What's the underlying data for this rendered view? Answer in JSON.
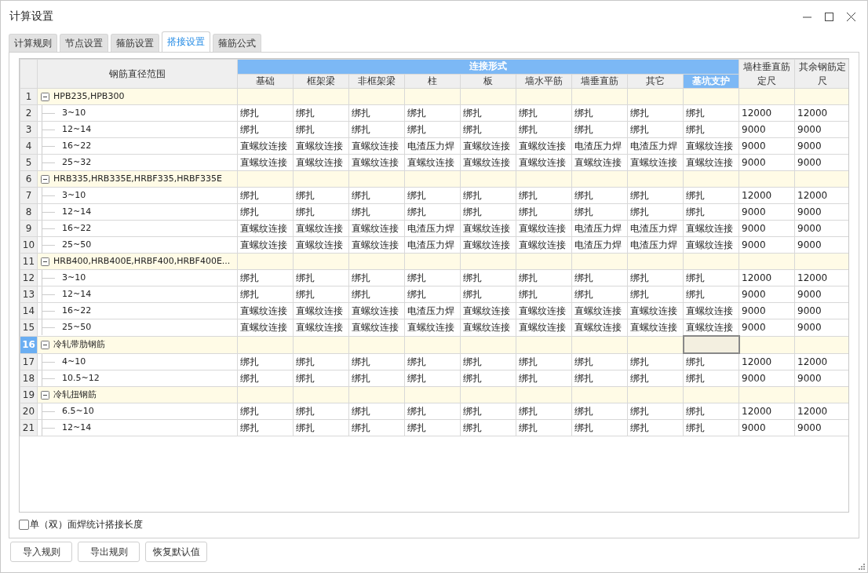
{
  "window": {
    "title": "计算设置"
  },
  "tabs": [
    {
      "label": "计算规则",
      "selected": false
    },
    {
      "label": "节点设置",
      "selected": false
    },
    {
      "label": "箍筋设置",
      "selected": false
    },
    {
      "label": "搭接设置",
      "selected": true
    },
    {
      "label": "箍筋公式",
      "selected": false
    }
  ],
  "table": {
    "name_header": "钢筋直径范围",
    "group_header": "连接形式",
    "columns": [
      {
        "label": "基础",
        "selected": false
      },
      {
        "label": "框架梁",
        "selected": false
      },
      {
        "label": "非框架梁",
        "selected": false
      },
      {
        "label": "柱",
        "selected": false
      },
      {
        "label": "板",
        "selected": false
      },
      {
        "label": "墙水平筋",
        "selected": false
      },
      {
        "label": "墙垂直筋",
        "selected": false
      },
      {
        "label": "其它",
        "selected": false
      },
      {
        "label": "基坑支护",
        "selected": true
      }
    ],
    "extra_columns": [
      "墙柱垂直筋定尺",
      "其余钢筋定尺"
    ],
    "rows": [
      {
        "number": "1",
        "selected": false,
        "kind": "group",
        "label": "HPB235,HPB300",
        "expanded": true
      },
      {
        "number": "2",
        "selected": false,
        "kind": "item",
        "label": "3~10",
        "cells": [
          "绑扎",
          "绑扎",
          "绑扎",
          "绑扎",
          "绑扎",
          "绑扎",
          "绑扎",
          "绑扎",
          "绑扎",
          "12000",
          "12000"
        ]
      },
      {
        "number": "3",
        "selected": false,
        "kind": "item",
        "label": "12~14",
        "cells": [
          "绑扎",
          "绑扎",
          "绑扎",
          "绑扎",
          "绑扎",
          "绑扎",
          "绑扎",
          "绑扎",
          "绑扎",
          "9000",
          "9000"
        ]
      },
      {
        "number": "4",
        "selected": false,
        "kind": "item",
        "label": "16~22",
        "cells": [
          "直螺纹连接",
          "直螺纹连接",
          "直螺纹连接",
          "电渣压力焊",
          "直螺纹连接",
          "直螺纹连接",
          "电渣压力焊",
          "电渣压力焊",
          "直螺纹连接",
          "9000",
          "9000"
        ]
      },
      {
        "number": "5",
        "selected": false,
        "kind": "item",
        "label": "25~32",
        "cells": [
          "直螺纹连接",
          "直螺纹连接",
          "直螺纹连接",
          "直螺纹连接",
          "直螺纹连接",
          "直螺纹连接",
          "直螺纹连接",
          "直螺纹连接",
          "直螺纹连接",
          "9000",
          "9000"
        ]
      },
      {
        "number": "6",
        "selected": false,
        "kind": "group",
        "label": "HRB335,HRB335E,HRBF335,HRBF335E",
        "expanded": true
      },
      {
        "number": "7",
        "selected": false,
        "kind": "item",
        "label": "3~10",
        "cells": [
          "绑扎",
          "绑扎",
          "绑扎",
          "绑扎",
          "绑扎",
          "绑扎",
          "绑扎",
          "绑扎",
          "绑扎",
          "12000",
          "12000"
        ]
      },
      {
        "number": "8",
        "selected": false,
        "kind": "item",
        "label": "12~14",
        "cells": [
          "绑扎",
          "绑扎",
          "绑扎",
          "绑扎",
          "绑扎",
          "绑扎",
          "绑扎",
          "绑扎",
          "绑扎",
          "9000",
          "9000"
        ]
      },
      {
        "number": "9",
        "selected": false,
        "kind": "item",
        "label": "16~22",
        "cells": [
          "直螺纹连接",
          "直螺纹连接",
          "直螺纹连接",
          "电渣压力焊",
          "直螺纹连接",
          "直螺纹连接",
          "电渣压力焊",
          "电渣压力焊",
          "直螺纹连接",
          "9000",
          "9000"
        ]
      },
      {
        "number": "10",
        "selected": false,
        "kind": "item",
        "label": "25~50",
        "cells": [
          "直螺纹连接",
          "直螺纹连接",
          "直螺纹连接",
          "电渣压力焊",
          "直螺纹连接",
          "直螺纹连接",
          "电渣压力焊",
          "电渣压力焊",
          "直螺纹连接",
          "9000",
          "9000"
        ]
      },
      {
        "number": "11",
        "selected": false,
        "kind": "group",
        "label": "HRB400,HRB400E,HRBF400,HRBF400E...",
        "expanded": true
      },
      {
        "number": "12",
        "selected": false,
        "kind": "item",
        "label": "3~10",
        "cells": [
          "绑扎",
          "绑扎",
          "绑扎",
          "绑扎",
          "绑扎",
          "绑扎",
          "绑扎",
          "绑扎",
          "绑扎",
          "12000",
          "12000"
        ]
      },
      {
        "number": "13",
        "selected": false,
        "kind": "item",
        "label": "12~14",
        "cells": [
          "绑扎",
          "绑扎",
          "绑扎",
          "绑扎",
          "绑扎",
          "绑扎",
          "绑扎",
          "绑扎",
          "绑扎",
          "9000",
          "9000"
        ]
      },
      {
        "number": "14",
        "selected": false,
        "kind": "item",
        "label": "16~22",
        "cells": [
          "直螺纹连接",
          "直螺纹连接",
          "直螺纹连接",
          "电渣压力焊",
          "直螺纹连接",
          "直螺纹连接",
          "直螺纹连接",
          "直螺纹连接",
          "直螺纹连接",
          "9000",
          "9000"
        ]
      },
      {
        "number": "15",
        "selected": false,
        "kind": "item",
        "label": "25~50",
        "cells": [
          "直螺纹连接",
          "直螺纹连接",
          "直螺纹连接",
          "直螺纹连接",
          "直螺纹连接",
          "直螺纹连接",
          "直螺纹连接",
          "直螺纹连接",
          "直螺纹连接",
          "9000",
          "9000"
        ]
      },
      {
        "number": "16",
        "selected": true,
        "kind": "group",
        "label": "冷轧带肋钢筋",
        "expanded": true,
        "blank_cells": [
          {
            "focused": false
          },
          {
            "focused": false
          },
          {
            "focused": false
          },
          {
            "focused": false
          },
          {
            "focused": false
          },
          {
            "focused": false
          },
          {
            "focused": false
          },
          {
            "focused": false
          },
          {
            "focused": true
          },
          {
            "focused": false
          },
          {
            "focused": false
          }
        ]
      },
      {
        "number": "17",
        "selected": false,
        "kind": "item",
        "label": "4~10",
        "cells": [
          "绑扎",
          "绑扎",
          "绑扎",
          "绑扎",
          "绑扎",
          "绑扎",
          "绑扎",
          "绑扎",
          "绑扎",
          "12000",
          "12000"
        ]
      },
      {
        "number": "18",
        "selected": false,
        "kind": "item",
        "label": "10.5~12",
        "cells": [
          "绑扎",
          "绑扎",
          "绑扎",
          "绑扎",
          "绑扎",
          "绑扎",
          "绑扎",
          "绑扎",
          "绑扎",
          "9000",
          "9000"
        ]
      },
      {
        "number": "19",
        "selected": false,
        "kind": "group",
        "label": "冷轧扭钢筋",
        "expanded": true
      },
      {
        "number": "20",
        "selected": false,
        "kind": "item",
        "label": "6.5~10",
        "cells": [
          "绑扎",
          "绑扎",
          "绑扎",
          "绑扎",
          "绑扎",
          "绑扎",
          "绑扎",
          "绑扎",
          "绑扎",
          "12000",
          "12000"
        ]
      },
      {
        "number": "21",
        "selected": false,
        "kind": "item",
        "label": "12~14",
        "cells": [
          "绑扎",
          "绑扎",
          "绑扎",
          "绑扎",
          "绑扎",
          "绑扎",
          "绑扎",
          "绑扎",
          "绑扎",
          "9000",
          "9000"
        ]
      }
    ]
  },
  "option": {
    "label": "单（双）面焊统计搭接长度",
    "checked": false
  },
  "buttons": [
    "导入规则",
    "导出规则",
    "恢复默认值"
  ]
}
